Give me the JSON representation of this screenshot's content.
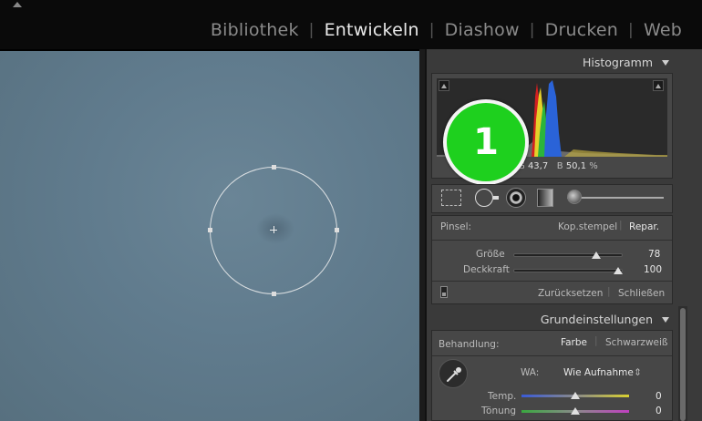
{
  "topbar": {
    "modules": [
      "Bibliothek",
      "Entwickeln",
      "Diashow",
      "Drucken",
      "Web"
    ],
    "active": "Entwickeln"
  },
  "histogram": {
    "title": "Histogramm",
    "readout_g_label": "G",
    "readout_g": "43,7",
    "readout_b_label": "B",
    "readout_b": "50,1",
    "readout_unit": "%"
  },
  "badge": {
    "label": "1"
  },
  "brush": {
    "label": "Pinsel:",
    "mode_clone": "Kop.stempel",
    "mode_heal": "Repar.",
    "size_label": "Größe",
    "size_value": "78",
    "size_level": 0.78,
    "opacity_label": "Deckkraft",
    "opacity_value": "100",
    "opacity_level": 1.0,
    "reset_label": "Zurücksetzen",
    "close_label": "Schließen"
  },
  "basic": {
    "title": "Grundeinstellungen",
    "treatment_label": "Behandlung:",
    "treatment_color": "Farbe",
    "treatment_bw": "Schwarzweiß",
    "wb_label": "WA:",
    "wb_value": "Wie Aufnahme",
    "wb_arrows": "⇕",
    "temp_label": "Temp.",
    "temp_value": "0",
    "tint_label": "Tönung",
    "tint_value": "0"
  },
  "colors": {
    "badge": "#1ed01e",
    "panel": "#3a3a3a",
    "photo": "#607b8d"
  }
}
